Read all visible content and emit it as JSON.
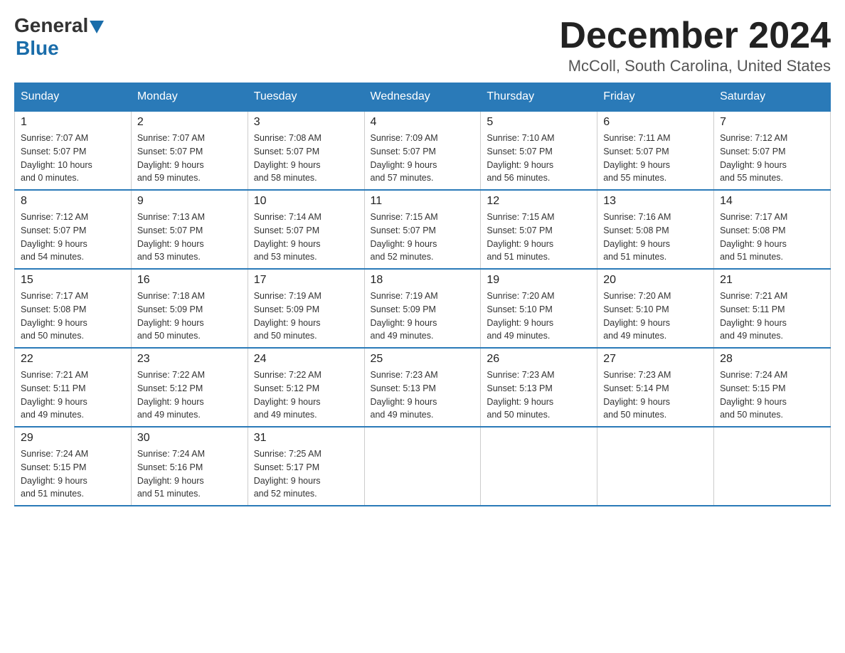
{
  "header": {
    "logo_general": "General",
    "logo_blue": "Blue",
    "month_title": "December 2024",
    "location": "McColl, South Carolina, United States"
  },
  "weekdays": [
    "Sunday",
    "Monday",
    "Tuesday",
    "Wednesday",
    "Thursday",
    "Friday",
    "Saturday"
  ],
  "weeks": [
    [
      {
        "day": "1",
        "sunrise": "7:07 AM",
        "sunset": "5:07 PM",
        "daylight": "10 hours and 0 minutes."
      },
      {
        "day": "2",
        "sunrise": "7:07 AM",
        "sunset": "5:07 PM",
        "daylight": "9 hours and 59 minutes."
      },
      {
        "day": "3",
        "sunrise": "7:08 AM",
        "sunset": "5:07 PM",
        "daylight": "9 hours and 58 minutes."
      },
      {
        "day": "4",
        "sunrise": "7:09 AM",
        "sunset": "5:07 PM",
        "daylight": "9 hours and 57 minutes."
      },
      {
        "day": "5",
        "sunrise": "7:10 AM",
        "sunset": "5:07 PM",
        "daylight": "9 hours and 56 minutes."
      },
      {
        "day": "6",
        "sunrise": "7:11 AM",
        "sunset": "5:07 PM",
        "daylight": "9 hours and 55 minutes."
      },
      {
        "day": "7",
        "sunrise": "7:12 AM",
        "sunset": "5:07 PM",
        "daylight": "9 hours and 55 minutes."
      }
    ],
    [
      {
        "day": "8",
        "sunrise": "7:12 AM",
        "sunset": "5:07 PM",
        "daylight": "9 hours and 54 minutes."
      },
      {
        "day": "9",
        "sunrise": "7:13 AM",
        "sunset": "5:07 PM",
        "daylight": "9 hours and 53 minutes."
      },
      {
        "day": "10",
        "sunrise": "7:14 AM",
        "sunset": "5:07 PM",
        "daylight": "9 hours and 53 minutes."
      },
      {
        "day": "11",
        "sunrise": "7:15 AM",
        "sunset": "5:07 PM",
        "daylight": "9 hours and 52 minutes."
      },
      {
        "day": "12",
        "sunrise": "7:15 AM",
        "sunset": "5:07 PM",
        "daylight": "9 hours and 51 minutes."
      },
      {
        "day": "13",
        "sunrise": "7:16 AM",
        "sunset": "5:08 PM",
        "daylight": "9 hours and 51 minutes."
      },
      {
        "day": "14",
        "sunrise": "7:17 AM",
        "sunset": "5:08 PM",
        "daylight": "9 hours and 51 minutes."
      }
    ],
    [
      {
        "day": "15",
        "sunrise": "7:17 AM",
        "sunset": "5:08 PM",
        "daylight": "9 hours and 50 minutes."
      },
      {
        "day": "16",
        "sunrise": "7:18 AM",
        "sunset": "5:09 PM",
        "daylight": "9 hours and 50 minutes."
      },
      {
        "day": "17",
        "sunrise": "7:19 AM",
        "sunset": "5:09 PM",
        "daylight": "9 hours and 50 minutes."
      },
      {
        "day": "18",
        "sunrise": "7:19 AM",
        "sunset": "5:09 PM",
        "daylight": "9 hours and 49 minutes."
      },
      {
        "day": "19",
        "sunrise": "7:20 AM",
        "sunset": "5:10 PM",
        "daylight": "9 hours and 49 minutes."
      },
      {
        "day": "20",
        "sunrise": "7:20 AM",
        "sunset": "5:10 PM",
        "daylight": "9 hours and 49 minutes."
      },
      {
        "day": "21",
        "sunrise": "7:21 AM",
        "sunset": "5:11 PM",
        "daylight": "9 hours and 49 minutes."
      }
    ],
    [
      {
        "day": "22",
        "sunrise": "7:21 AM",
        "sunset": "5:11 PM",
        "daylight": "9 hours and 49 minutes."
      },
      {
        "day": "23",
        "sunrise": "7:22 AM",
        "sunset": "5:12 PM",
        "daylight": "9 hours and 49 minutes."
      },
      {
        "day": "24",
        "sunrise": "7:22 AM",
        "sunset": "5:12 PM",
        "daylight": "9 hours and 49 minutes."
      },
      {
        "day": "25",
        "sunrise": "7:23 AM",
        "sunset": "5:13 PM",
        "daylight": "9 hours and 49 minutes."
      },
      {
        "day": "26",
        "sunrise": "7:23 AM",
        "sunset": "5:13 PM",
        "daylight": "9 hours and 50 minutes."
      },
      {
        "day": "27",
        "sunrise": "7:23 AM",
        "sunset": "5:14 PM",
        "daylight": "9 hours and 50 minutes."
      },
      {
        "day": "28",
        "sunrise": "7:24 AM",
        "sunset": "5:15 PM",
        "daylight": "9 hours and 50 minutes."
      }
    ],
    [
      {
        "day": "29",
        "sunrise": "7:24 AM",
        "sunset": "5:15 PM",
        "daylight": "9 hours and 51 minutes."
      },
      {
        "day": "30",
        "sunrise": "7:24 AM",
        "sunset": "5:16 PM",
        "daylight": "9 hours and 51 minutes."
      },
      {
        "day": "31",
        "sunrise": "7:25 AM",
        "sunset": "5:17 PM",
        "daylight": "9 hours and 52 minutes."
      },
      null,
      null,
      null,
      null
    ]
  ],
  "labels": {
    "sunrise": "Sunrise:",
    "sunset": "Sunset:",
    "daylight": "Daylight:"
  }
}
